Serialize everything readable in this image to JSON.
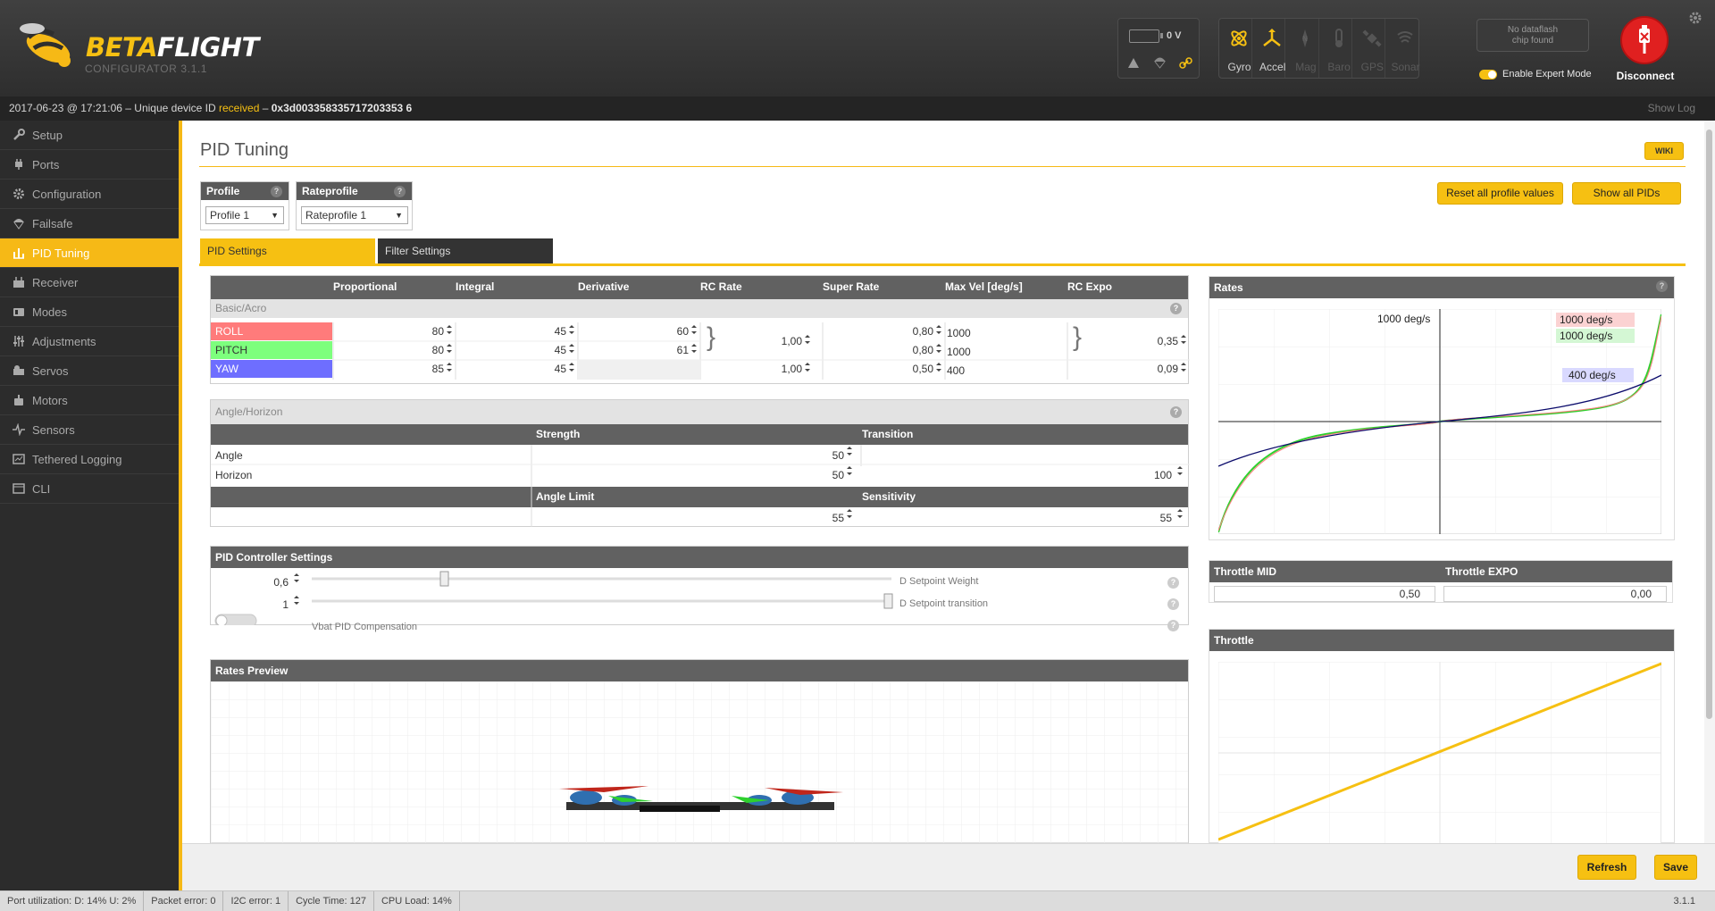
{
  "app": {
    "name_beta": "BETA",
    "name_flight": "FLIGHT",
    "subtitle": "CONFIGURATOR  3.1.1"
  },
  "battery": {
    "voltage": "0 V"
  },
  "sensors": [
    {
      "label": "Gyro",
      "icon": "gyro-icon",
      "active": true
    },
    {
      "label": "Accel",
      "icon": "accel-icon",
      "active": true
    },
    {
      "label": "Mag",
      "icon": "mag-icon",
      "active": false
    },
    {
      "label": "Baro",
      "icon": "baro-icon",
      "active": false
    },
    {
      "label": "GPS",
      "icon": "gps-icon",
      "active": false
    },
    {
      "label": "Sonar",
      "icon": "sonar-icon",
      "active": false
    }
  ],
  "dataflash": {
    "line1": "No dataflash",
    "line2": "chip found"
  },
  "expert_mode": {
    "label": "Enable Expert Mode"
  },
  "disconnect": {
    "label": "Disconnect"
  },
  "log": {
    "timestamp": "2017-06-23 @ 17:21:06",
    "prefix": " – Unique device ID ",
    "received": "received",
    "sep": " – ",
    "device_id": "0x3d003358335717203353 6",
    "show_log": "Show Log"
  },
  "nav": [
    {
      "label": "Setup",
      "icon": "wrench-icon"
    },
    {
      "label": "Ports",
      "icon": "plug-icon"
    },
    {
      "label": "Configuration",
      "icon": "gear-icon"
    },
    {
      "label": "Failsafe",
      "icon": "parachute-icon"
    },
    {
      "label": "PID Tuning",
      "icon": "sliders-icon",
      "active": true
    },
    {
      "label": "Receiver",
      "icon": "receiver-icon"
    },
    {
      "label": "Modes",
      "icon": "modes-icon"
    },
    {
      "label": "Adjustments",
      "icon": "adjustments-icon"
    },
    {
      "label": "Servos",
      "icon": "servo-icon"
    },
    {
      "label": "Motors",
      "icon": "motor-icon"
    },
    {
      "label": "Sensors",
      "icon": "pulse-icon"
    },
    {
      "label": "Tethered Logging",
      "icon": "log-icon"
    },
    {
      "label": "CLI",
      "icon": "terminal-icon"
    }
  ],
  "page": {
    "title": "PID Tuning",
    "wiki": "WIKI"
  },
  "profile": {
    "label": "Profile",
    "value": "Profile 1"
  },
  "rateprofile": {
    "label": "Rateprofile",
    "value": "Rateprofile 1"
  },
  "buttons": {
    "reset": "Reset all profile values",
    "show_all": "Show all PIDs",
    "refresh": "Refresh",
    "save": "Save"
  },
  "tabs": {
    "pid_settings": "PID Settings",
    "filter_settings": "Filter Settings"
  },
  "pid_table": {
    "headers": [
      "Proportional",
      "Integral",
      "Derivative",
      "RC Rate",
      "Super Rate",
      "Max Vel [deg/s]",
      "RC Expo"
    ],
    "section": "Basic/Acro",
    "rows": [
      {
        "name": "ROLL",
        "color": "#ff7b7b",
        "p": "80",
        "i": "45",
        "d": "60",
        "rc_rate": "1,00",
        "super_rate": "0,80",
        "max_vel": "1000",
        "expo": "0,35"
      },
      {
        "name": "PITCH",
        "color": "#7dff7d",
        "p": "80",
        "i": "45",
        "d": "61",
        "super_rate": "0,80",
        "max_vel": "1000"
      },
      {
        "name": "YAW",
        "color": "#6e6eff",
        "p": "85",
        "i": "45",
        "d": "",
        "rc_rate": "1,00",
        "super_rate": "0,50",
        "max_vel": "400",
        "expo": "0,09"
      }
    ]
  },
  "angle": {
    "section": "Angle/Horizon",
    "strength_h": "Strength",
    "transition_h": "Transition",
    "angle_label": "Angle",
    "angle_strength": "50",
    "horizon_label": "Horizon",
    "horizon_strength": "50",
    "horizon_transition": "100",
    "limit_h": "Angle Limit",
    "sens_h": "Sensitivity",
    "limit": "55",
    "sens": "55"
  },
  "controller": {
    "title": "PID Controller Settings",
    "d_weight": "0,6",
    "d_weight_label": "D Setpoint Weight",
    "d_transition": "1",
    "d_transition_label": "D Setpoint transition",
    "vbat_label": "Vbat PID Compensation"
  },
  "rates_preview": {
    "title": "Rates Preview"
  },
  "rates": {
    "title": "Rates",
    "label_top": "1000 deg/s",
    "roll_label": "1000 deg/s",
    "pitch_label": "1000 deg/s",
    "yaw_label": "400 deg/s"
  },
  "throttle_mid": {
    "label": "Throttle MID",
    "value": "0,50"
  },
  "throttle_expo": {
    "label": "Throttle EXPO",
    "value": "0,00"
  },
  "throttle": {
    "title": "Throttle"
  },
  "status": {
    "port": "Port utilization: D: 14% U: 2%",
    "packet": "Packet error: 0",
    "i2c": "I2C error: 1",
    "cycle": "Cycle Time: 127",
    "cpu": "CPU Load: 14%",
    "version": "3.1.1"
  },
  "colors": {
    "accent": "#f6c012",
    "roll": "#ff7b7b",
    "pitch": "#7dff7d",
    "yaw": "#6e6eff"
  }
}
